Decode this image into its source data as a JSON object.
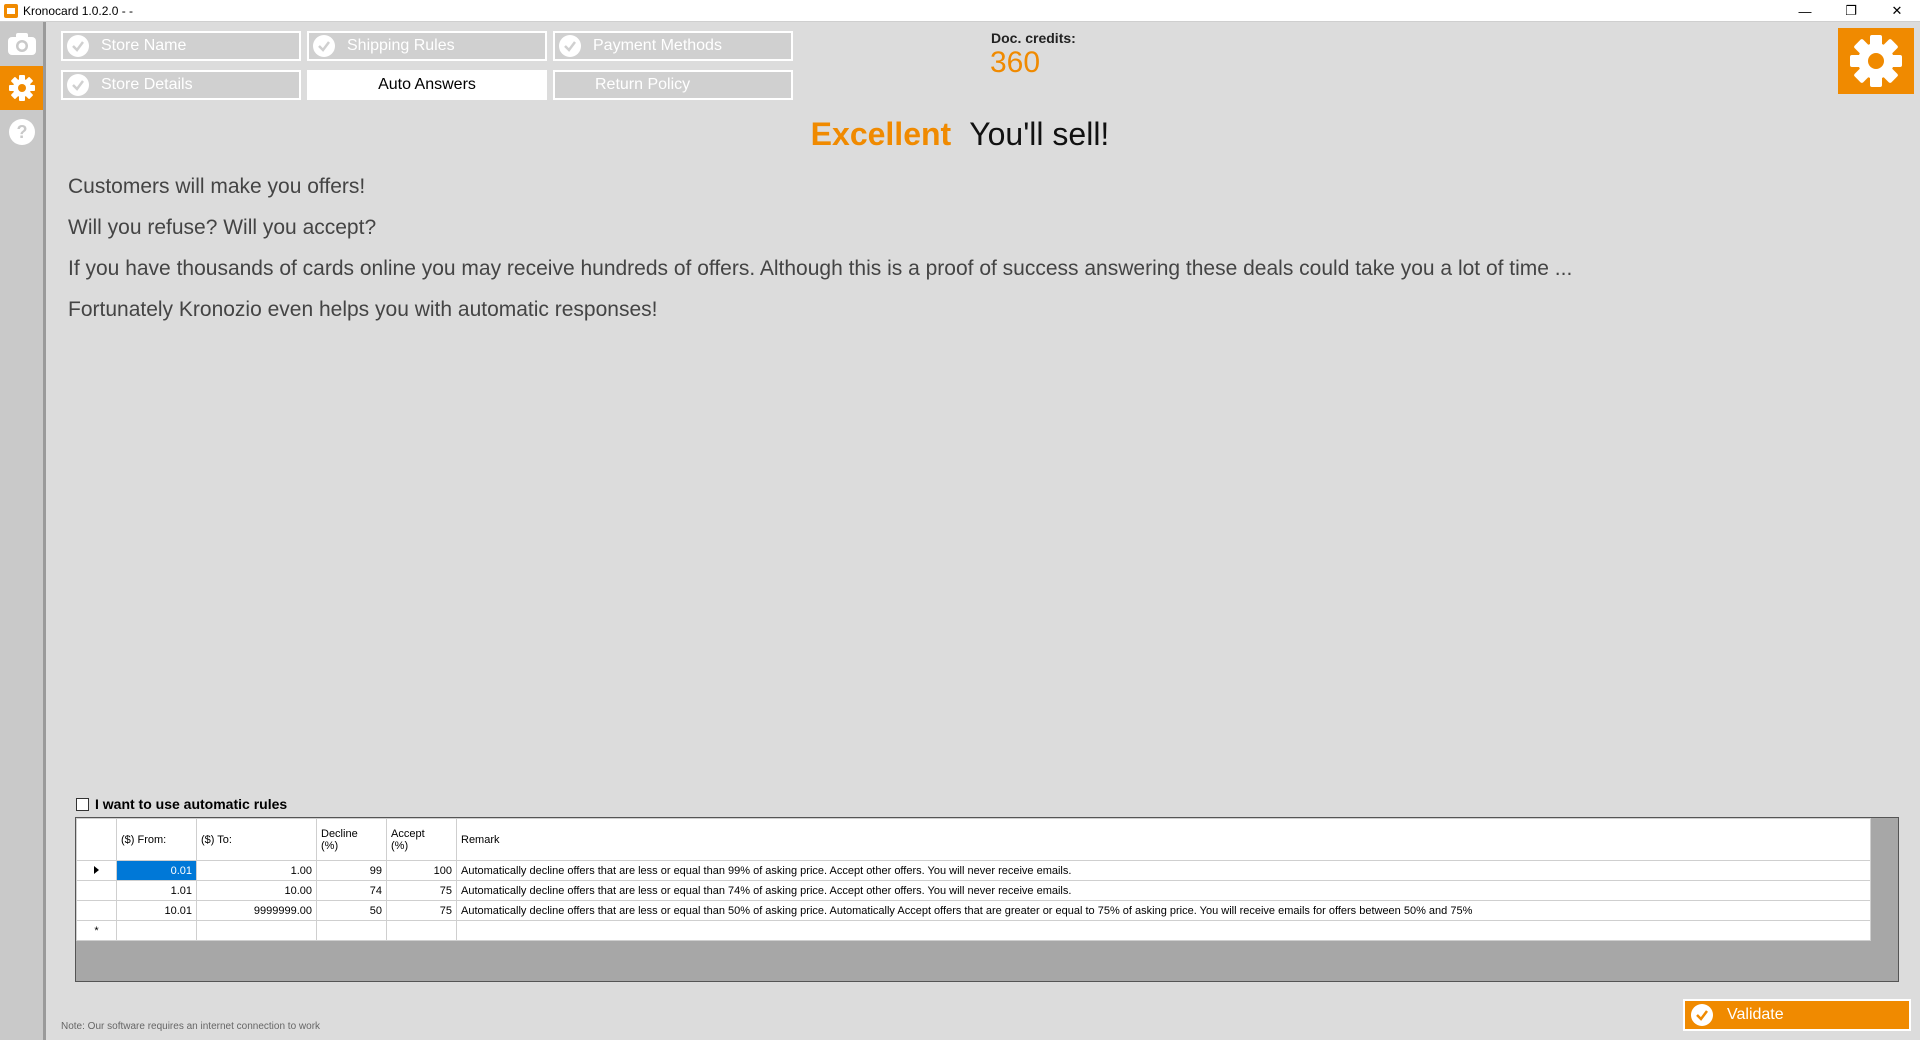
{
  "window": {
    "title": "Kronocard 1.0.2.0 -  -",
    "controls": {
      "minimize": "—",
      "restore": "❐",
      "close": "✕"
    }
  },
  "sidebar": {
    "items": [
      {
        "icon": "camera-icon"
      },
      {
        "icon": "gear-icon",
        "active": true
      },
      {
        "icon": "help-icon"
      }
    ]
  },
  "tabs": {
    "store_name": "Store Name",
    "shipping_rules": "Shipping Rules",
    "payment_methods": "Payment Methods",
    "store_details": "Store Details",
    "auto_answers": "Auto Answers",
    "return_policy": "Return Policy"
  },
  "credits": {
    "label": "Doc. credits:",
    "value": "360"
  },
  "headline": {
    "emphasis": "Excellent",
    "text": "You'll sell!"
  },
  "paragraphs": [
    "Customers will make you offers!",
    "Will you refuse? Will you accept?",
    "If you have thousands of cards online you may receive hundreds of offers. Although this is a proof of success answering these deals could take you a lot of time ...",
    "Fortunately Kronozio even helps you with automatic responses!"
  ],
  "auto_rules": {
    "checkbox_label": "I want to use automatic rules",
    "checked": false,
    "columns": {
      "from": "($) From:",
      "to": "($) To:",
      "decline": "Decline\n(%)",
      "accept": "Accept\n(%)",
      "remark": "Remark"
    },
    "rows": [
      {
        "from": "0.01",
        "to": "1.00",
        "decline": "99",
        "accept": "100",
        "remark": "Automatically decline offers that are less or equal than 99% of asking price. Accept other offers. You will never receive emails."
      },
      {
        "from": "1.01",
        "to": "10.00",
        "decline": "74",
        "accept": "75",
        "remark": "Automatically decline offers that are less or equal than 74% of asking price. Accept other offers. You will never receive emails."
      },
      {
        "from": "10.01",
        "to": "9999999.00",
        "decline": "50",
        "accept": "75",
        "remark": "Automatically decline offers that are less or equal than 50% of asking price. Automatically Accept offers that are greater or equal to 75% of asking price. You will receive emails for offers between 50% and 75%"
      }
    ],
    "new_row_marker": "*"
  },
  "footer": {
    "note": "Note: Our software requires an internet connection to work",
    "validate_label": "Validate"
  },
  "colors": {
    "accent": "#f08a00",
    "selection": "#0078d7"
  }
}
